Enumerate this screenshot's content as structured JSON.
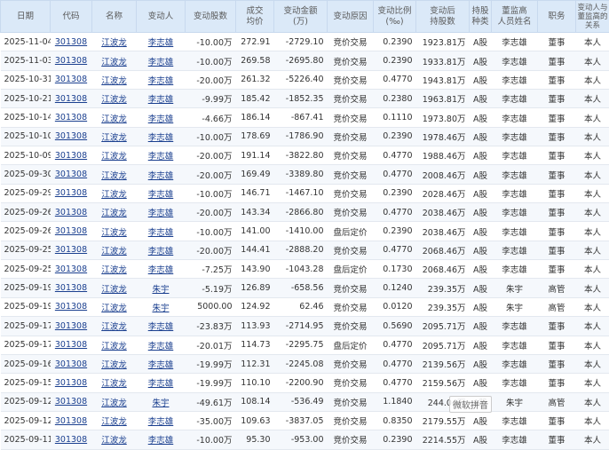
{
  "headers": {
    "date": "日期",
    "code": "代码",
    "name": "名称",
    "person": "变动人",
    "shares": "变动股数",
    "price": "成交\n均价",
    "amount": "变动金额\n(万)",
    "reason": "变动原因",
    "ratio": "变动比例\n(‰)",
    "holding": "变动后\n持股数",
    "type": "持股\n种类",
    "exec": "董监高\n人员姓名",
    "position": "职务",
    "relation": "变动人与\n董监高的\n关系"
  },
  "rows": [
    {
      "date": "2025-11-04",
      "code": "301308",
      "name": "江波龙",
      "person": "李志雄",
      "shares": "-10.00万",
      "price": "272.91",
      "amount": "-2729.10",
      "reason": "竞价交易",
      "ratio": "0.2390",
      "holding": "1923.81万",
      "type": "A股",
      "exec": "李志雄",
      "position": "董事",
      "relation": "本人"
    },
    {
      "date": "2025-11-03",
      "code": "301308",
      "name": "江波龙",
      "person": "李志雄",
      "shares": "-10.00万",
      "price": "269.58",
      "amount": "-2695.80",
      "reason": "竞价交易",
      "ratio": "0.2390",
      "holding": "1933.81万",
      "type": "A股",
      "exec": "李志雄",
      "position": "董事",
      "relation": "本人"
    },
    {
      "date": "2025-10-31",
      "code": "301308",
      "name": "江波龙",
      "person": "李志雄",
      "shares": "-20.00万",
      "price": "261.32",
      "amount": "-5226.40",
      "reason": "竞价交易",
      "ratio": "0.4770",
      "holding": "1943.81万",
      "type": "A股",
      "exec": "李志雄",
      "position": "董事",
      "relation": "本人"
    },
    {
      "date": "2025-10-21",
      "code": "301308",
      "name": "江波龙",
      "person": "李志雄",
      "shares": "-9.99万",
      "price": "185.42",
      "amount": "-1852.35",
      "reason": "竞价交易",
      "ratio": "0.2380",
      "holding": "1963.81万",
      "type": "A股",
      "exec": "李志雄",
      "position": "董事",
      "relation": "本人"
    },
    {
      "date": "2025-10-14",
      "code": "301308",
      "name": "江波龙",
      "person": "李志雄",
      "shares": "-4.66万",
      "price": "186.14",
      "amount": "-867.41",
      "reason": "竞价交易",
      "ratio": "0.1110",
      "holding": "1973.80万",
      "type": "A股",
      "exec": "李志雄",
      "position": "董事",
      "relation": "本人"
    },
    {
      "date": "2025-10-10",
      "code": "301308",
      "name": "江波龙",
      "person": "李志雄",
      "shares": "-10.00万",
      "price": "178.69",
      "amount": "-1786.90",
      "reason": "竞价交易",
      "ratio": "0.2390",
      "holding": "1978.46万",
      "type": "A股",
      "exec": "李志雄",
      "position": "董事",
      "relation": "本人"
    },
    {
      "date": "2025-10-09",
      "code": "301308",
      "name": "江波龙",
      "person": "李志雄",
      "shares": "-20.00万",
      "price": "191.14",
      "amount": "-3822.80",
      "reason": "竞价交易",
      "ratio": "0.4770",
      "holding": "1988.46万",
      "type": "A股",
      "exec": "李志雄",
      "position": "董事",
      "relation": "本人"
    },
    {
      "date": "2025-09-30",
      "code": "301308",
      "name": "江波龙",
      "person": "李志雄",
      "shares": "-20.00万",
      "price": "169.49",
      "amount": "-3389.80",
      "reason": "竞价交易",
      "ratio": "0.4770",
      "holding": "2008.46万",
      "type": "A股",
      "exec": "李志雄",
      "position": "董事",
      "relation": "本人"
    },
    {
      "date": "2025-09-29",
      "code": "301308",
      "name": "江波龙",
      "person": "李志雄",
      "shares": "-10.00万",
      "price": "146.71",
      "amount": "-1467.10",
      "reason": "竞价交易",
      "ratio": "0.2390",
      "holding": "2028.46万",
      "type": "A股",
      "exec": "李志雄",
      "position": "董事",
      "relation": "本人"
    },
    {
      "date": "2025-09-26",
      "code": "301308",
      "name": "江波龙",
      "person": "李志雄",
      "shares": "-20.00万",
      "price": "143.34",
      "amount": "-2866.80",
      "reason": "竞价交易",
      "ratio": "0.4770",
      "holding": "2038.46万",
      "type": "A股",
      "exec": "李志雄",
      "position": "董事",
      "relation": "本人"
    },
    {
      "date": "2025-09-26",
      "code": "301308",
      "name": "江波龙",
      "person": "李志雄",
      "shares": "-10.00万",
      "price": "141.00",
      "amount": "-1410.00",
      "reason": "盘后定价",
      "ratio": "0.2390",
      "holding": "2038.46万",
      "type": "A股",
      "exec": "李志雄",
      "position": "董事",
      "relation": "本人"
    },
    {
      "date": "2025-09-25",
      "code": "301308",
      "name": "江波龙",
      "person": "李志雄",
      "shares": "-20.00万",
      "price": "144.41",
      "amount": "-2888.20",
      "reason": "竞价交易",
      "ratio": "0.4770",
      "holding": "2068.46万",
      "type": "A股",
      "exec": "李志雄",
      "position": "董事",
      "relation": "本人"
    },
    {
      "date": "2025-09-25",
      "code": "301308",
      "name": "江波龙",
      "person": "李志雄",
      "shares": "-7.25万",
      "price": "143.90",
      "amount": "-1043.28",
      "reason": "盘后定价",
      "ratio": "0.1730",
      "holding": "2068.46万",
      "type": "A股",
      "exec": "李志雄",
      "position": "董事",
      "relation": "本人"
    },
    {
      "date": "2025-09-19",
      "code": "301308",
      "name": "江波龙",
      "person": "朱宇",
      "shares": "-5.19万",
      "price": "126.89",
      "amount": "-658.56",
      "reason": "竞价交易",
      "ratio": "0.1240",
      "holding": "239.35万",
      "type": "A股",
      "exec": "朱宇",
      "position": "高管",
      "relation": "本人"
    },
    {
      "date": "2025-09-19",
      "code": "301308",
      "name": "江波龙",
      "person": "朱宇",
      "shares": "5000.00",
      "price": "124.92",
      "amount": "62.46",
      "reason": "竞价交易",
      "ratio": "0.0120",
      "holding": "239.35万",
      "type": "A股",
      "exec": "朱宇",
      "position": "高管",
      "relation": "本人"
    },
    {
      "date": "2025-09-17",
      "code": "301308",
      "name": "江波龙",
      "person": "李志雄",
      "shares": "-23.83万",
      "price": "113.93",
      "amount": "-2714.95",
      "reason": "竞价交易",
      "ratio": "0.5690",
      "holding": "2095.71万",
      "type": "A股",
      "exec": "李志雄",
      "position": "董事",
      "relation": "本人"
    },
    {
      "date": "2025-09-17",
      "code": "301308",
      "name": "江波龙",
      "person": "李志雄",
      "shares": "-20.01万",
      "price": "114.73",
      "amount": "-2295.75",
      "reason": "盘后定价",
      "ratio": "0.4770",
      "holding": "2095.71万",
      "type": "A股",
      "exec": "李志雄",
      "position": "董事",
      "relation": "本人"
    },
    {
      "date": "2025-09-16",
      "code": "301308",
      "name": "江波龙",
      "person": "李志雄",
      "shares": "-19.99万",
      "price": "112.31",
      "amount": "-2245.08",
      "reason": "竞价交易",
      "ratio": "0.4770",
      "holding": "2139.56万",
      "type": "A股",
      "exec": "李志雄",
      "position": "董事",
      "relation": "本人"
    },
    {
      "date": "2025-09-15",
      "code": "301308",
      "name": "江波龙",
      "person": "李志雄",
      "shares": "-19.99万",
      "price": "110.10",
      "amount": "-2200.90",
      "reason": "竞价交易",
      "ratio": "0.4770",
      "holding": "2159.56万",
      "type": "A股",
      "exec": "李志雄",
      "position": "董事",
      "relation": "本人"
    },
    {
      "date": "2025-09-12",
      "code": "301308",
      "name": "江波龙",
      "person": "朱宇",
      "shares": "-49.61万",
      "price": "108.14",
      "amount": "-536.49",
      "reason": "竞价交易",
      "ratio": "1.1840",
      "holding": "244.04万",
      "type": "A股",
      "exec": "朱宇",
      "position": "高管",
      "relation": "本人"
    },
    {
      "date": "2025-09-12",
      "code": "301308",
      "name": "江波龙",
      "person": "李志雄",
      "shares": "-35.00万",
      "price": "109.63",
      "amount": "-3837.05",
      "reason": "竞价交易",
      "ratio": "0.8350",
      "holding": "2179.55万",
      "type": "A股",
      "exec": "李志雄",
      "position": "董事",
      "relation": "本人"
    },
    {
      "date": "2025-09-11",
      "code": "301308",
      "name": "江波龙",
      "person": "李志雄",
      "shares": "-10.00万",
      "price": "95.30",
      "amount": "-953.00",
      "reason": "竞价交易",
      "ratio": "0.2390",
      "holding": "2214.55万",
      "type": "A股",
      "exec": "李志雄",
      "position": "董事",
      "relation": "本人"
    }
  ],
  "overlay": {
    "watermark": "微软拼音"
  }
}
